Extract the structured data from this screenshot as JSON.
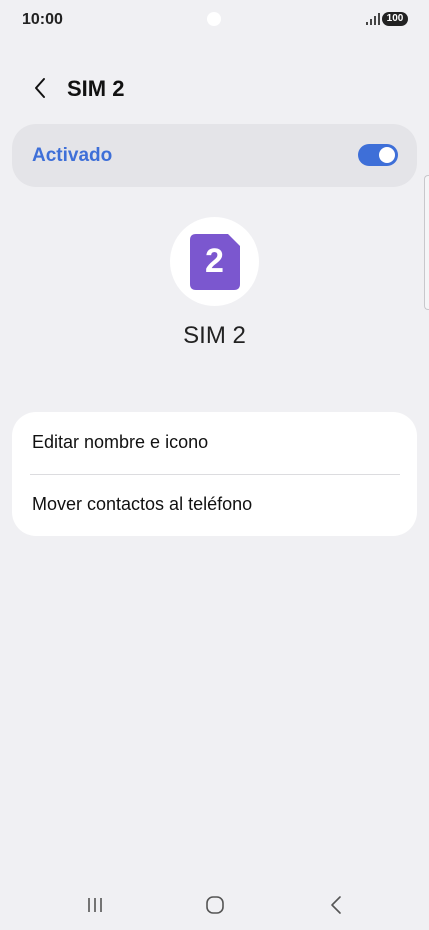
{
  "status_bar": {
    "time": "10:00",
    "battery": "100"
  },
  "header": {
    "title": "SIM 2"
  },
  "toggle": {
    "label": "Activado",
    "state": "on",
    "accent_color": "#3e6fd8"
  },
  "sim": {
    "icon_number": "2",
    "icon_color": "#7b57cf",
    "name": "SIM 2"
  },
  "options": [
    {
      "label": "Editar nombre e icono"
    },
    {
      "label": "Mover contactos al teléfono"
    }
  ],
  "nav": {
    "recents_icon": "recents-icon",
    "home_icon": "home-icon",
    "back_icon": "back-icon"
  }
}
